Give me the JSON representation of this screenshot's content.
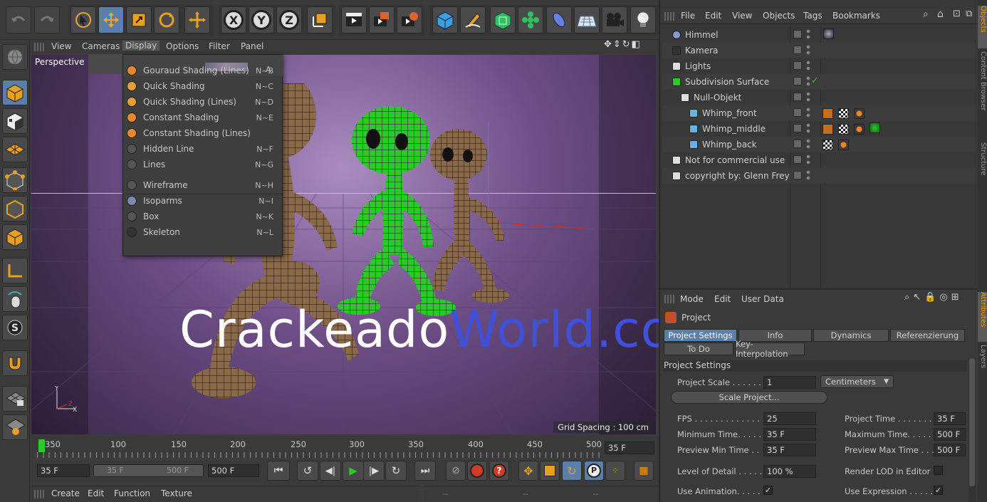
{
  "menus": {
    "viewport": [
      "View",
      "Cameras",
      "Display",
      "Options",
      "Filter",
      "Panel"
    ],
    "objects": [
      "File",
      "Edit",
      "View",
      "Objects",
      "Tags",
      "Bookmarks"
    ],
    "attributes": [
      "Mode",
      "Edit",
      "User Data"
    ],
    "bottom": [
      "Create",
      "Edit",
      "Function",
      "Texture"
    ]
  },
  "toolbar": {
    "axis_x": "X",
    "axis_y": "Y",
    "axis_z": "Z",
    "icons": [
      "undo-icon",
      "redo-icon",
      "live-select-icon",
      "move-icon",
      "scale-icon",
      "rotate-icon",
      "add-icon",
      "x-axis-icon",
      "y-axis-icon",
      "z-axis-icon",
      "coordinate-system-icon",
      "render-view-icon",
      "render-picture-viewer-icon",
      "render-settings-icon",
      "cube-icon",
      "pen-icon",
      "subdivision-icon",
      "mograph-icon",
      "deformer-icon",
      "environment-icon",
      "camera-icon",
      "light-icon"
    ]
  },
  "viewport": {
    "label": "Perspective",
    "grid_spacing": "Grid Spacing : 100 cm",
    "display_menu": [
      {
        "label": "Gouraud Shading (Lines)",
        "shortcut": "N~B",
        "icon": "gouraud-shading-icon"
      },
      {
        "label": "Quick Shading",
        "shortcut": "N~C",
        "icon": "quick-shading-icon"
      },
      {
        "label": "Quick Shading (Lines)",
        "shortcut": "N~D",
        "icon": "quick-shading-lines-icon"
      },
      {
        "label": "Constant Shading",
        "shortcut": "N~E",
        "icon": "constant-shading-icon"
      },
      {
        "label": "Constant Shading (Lines)",
        "shortcut": "",
        "icon": "constant-shading-lines-icon"
      },
      {
        "label": "Hidden Line",
        "shortcut": "N~F",
        "icon": "hidden-line-icon"
      },
      {
        "label": "Lines",
        "shortcut": "N~G",
        "icon": "lines-icon"
      },
      {
        "label": "Wireframe",
        "shortcut": "N~H",
        "icon": "wireframe-icon"
      },
      {
        "label": "Isoparms",
        "shortcut": "N~I",
        "icon": "isoparms-icon"
      },
      {
        "label": "Box",
        "shortcut": "N~K",
        "icon": "box-icon"
      },
      {
        "label": "Skeleton",
        "shortcut": "N~L",
        "icon": "skeleton-icon"
      }
    ],
    "first_shortcut": "A"
  },
  "watermark": {
    "part1": "Crackeado",
    "part2": "World",
    "part3": ".com"
  },
  "objects": [
    {
      "name": "Himmel",
      "indent": 0
    },
    {
      "name": "Kamera",
      "indent": 0
    },
    {
      "name": "Lights",
      "indent": 0
    },
    {
      "name": "Subdivision Surface",
      "indent": 0
    },
    {
      "name": "Null-Objekt",
      "indent": 1
    },
    {
      "name": "Whimp_front",
      "indent": 2
    },
    {
      "name": "Whimp_middle",
      "indent": 2
    },
    {
      "name": "Whimp_back",
      "indent": 2
    },
    {
      "name": "Not for commercial use",
      "indent": 0
    },
    {
      "name": "copyright by: Glenn Frey",
      "indent": 0
    }
  ],
  "attributes": {
    "title": "Project",
    "tabs_row1": [
      "Project Settings",
      "Info",
      "Dynamics",
      "Referenzierung"
    ],
    "tabs_row2": [
      "To Do",
      "Key-Interpolation"
    ],
    "section": "Project Settings",
    "project_scale_label": "Project Scale . . . . . .",
    "project_scale_value": "1",
    "project_scale_unit": "Centimeters",
    "scale_button": "Scale Project...",
    "fps_label": "FPS . . . . . . . . . . . . . . .",
    "fps_value": "25",
    "project_time_label": "Project Time . . . . . . . .",
    "project_time_value": "35 F",
    "min_time_label": "Minimum Time. . . . . .",
    "min_time_value": "35 F",
    "max_time_label": "Maximum Time. . . . . . .",
    "max_time_value": "500 F",
    "preview_min_label": "Preview Min Time . .",
    "preview_min_value": "35 F",
    "preview_max_label": "Preview Max Time . . .",
    "preview_max_value": "500 F",
    "lod_label": "Level of Detail . . . . .",
    "lod_value": "100 %",
    "render_lod_label": "Render LOD in Editor",
    "use_animation_label": "Use Animation. . . . .",
    "use_expression_label": "Use Expression . . . . . ."
  },
  "timeline": {
    "ticks": [
      "350",
      "100",
      "150",
      "200",
      "250",
      "300",
      "350",
      "400",
      "450",
      "500"
    ],
    "current": "35 F",
    "start": "35 F",
    "range_start": "35 F",
    "range_end": "500 F",
    "end": "500 F"
  },
  "side_tabs": [
    "Objects",
    "Content Browser",
    "Structure",
    "Attributes",
    "Layers"
  ],
  "colors": {
    "accent": "#5a7fa8",
    "watermark_white": "#ffffff",
    "watermark_blue": "#3f51d8",
    "green_mesh": "#2ec82e"
  }
}
